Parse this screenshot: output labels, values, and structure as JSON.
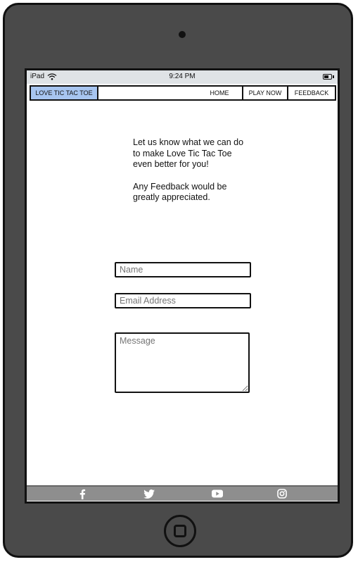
{
  "status": {
    "device": "iPad",
    "time": "9:24 PM"
  },
  "nav": {
    "brand": "LOVE TIC TAC TOE",
    "home": "HOME",
    "play_now": "PLAY NOW",
    "feedback": "FEEDBACK"
  },
  "intro": {
    "line1": "Let us know what we can do to make Love Tic Tac Toe even better for you!",
    "line2": "Any Feedback would be greatly appreciated."
  },
  "form": {
    "name_placeholder": "Name",
    "email_placeholder": "Email Address",
    "message_placeholder": "Message"
  },
  "social": {
    "icons": [
      "facebook-icon",
      "twitter-icon",
      "youtube-icon",
      "instagram-icon"
    ]
  },
  "colors": {
    "device_frame": "#4a4a4a",
    "brand_highlight": "#a7c5f0",
    "status_bar": "#dfe3e6",
    "footer": "#8e8e8e"
  }
}
